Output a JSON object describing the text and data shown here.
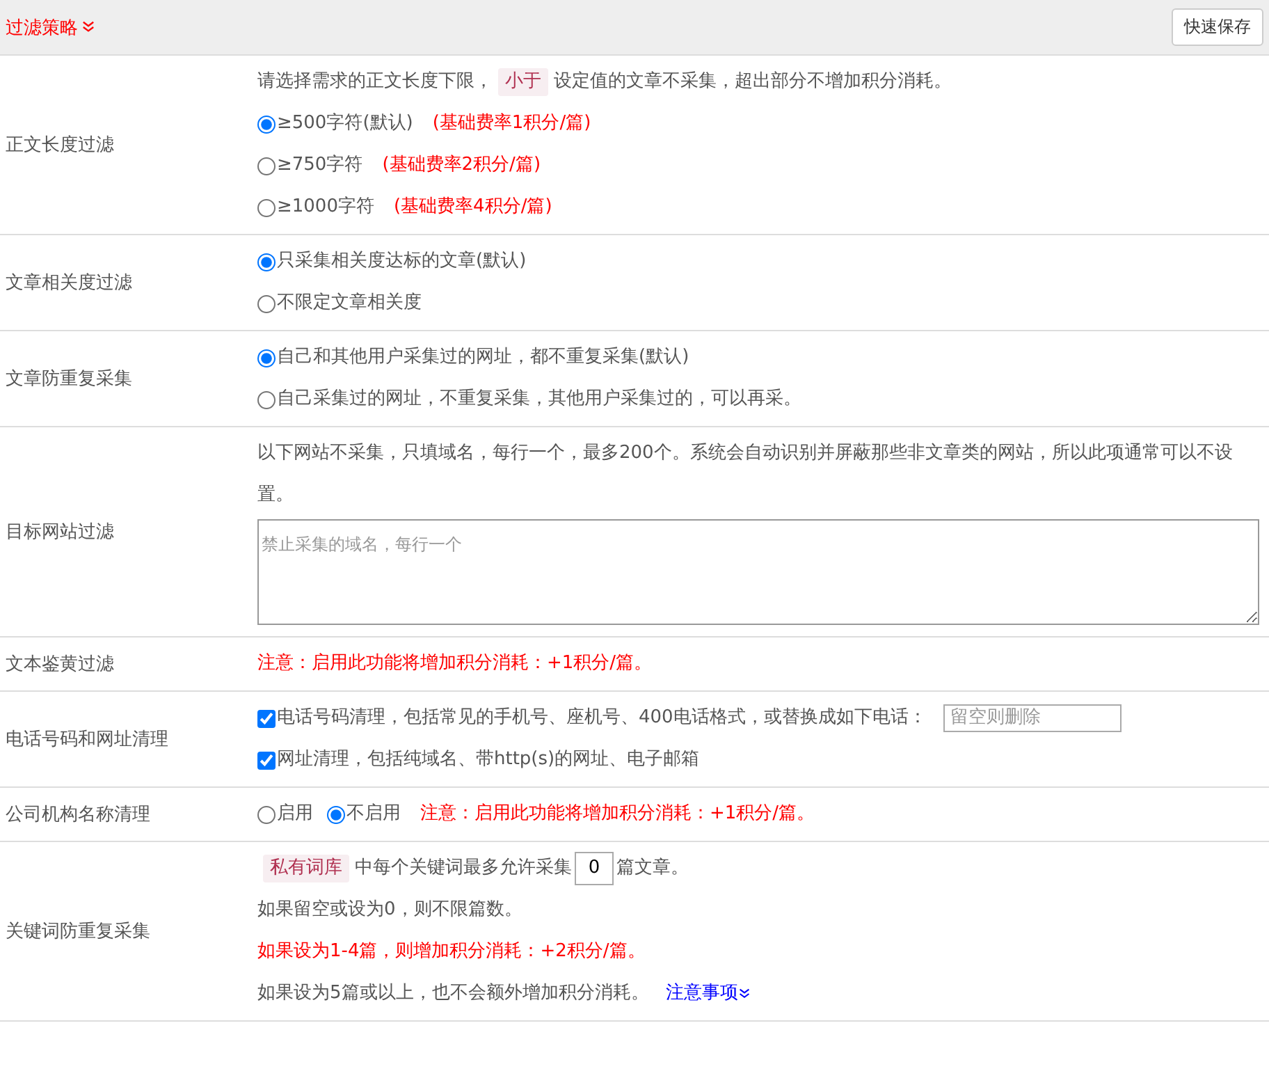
{
  "header": {
    "title": "过滤策略",
    "save_button": "快速保存"
  },
  "rows": [
    {
      "label": "正文长度过滤",
      "lines": [
        [
          {
            "kind": "text",
            "text": "请选择需求的正文长度下限，"
          },
          {
            "kind": "tag",
            "text": "小于"
          },
          {
            "kind": "text",
            "text": "设定值的文章不采集，超出部分不增加积分消耗。"
          }
        ],
        [
          {
            "kind": "radio",
            "text": "≥500字符(默认)",
            "selected": true
          },
          {
            "kind": "note",
            "text": "(基础费率1积分/篇)"
          }
        ],
        [
          {
            "kind": "radio",
            "text": "≥750字符",
            "selected": false
          },
          {
            "kind": "note",
            "text": "(基础费率2积分/篇)"
          }
        ],
        [
          {
            "kind": "radio",
            "text": "≥1000字符",
            "selected": false
          },
          {
            "kind": "note",
            "text": "(基础费率4积分/篇)"
          }
        ]
      ]
    },
    {
      "label": "文章相关度过滤",
      "lines": [
        [
          {
            "kind": "radio",
            "text": "只采集相关度达标的文章(默认)",
            "selected": true
          }
        ],
        [
          {
            "kind": "radio",
            "text": "不限定文章相关度",
            "selected": false
          }
        ]
      ]
    },
    {
      "label": "文章防重复采集",
      "lines": [
        [
          {
            "kind": "radio",
            "text": "自己和其他用户采集过的网址，都不重复采集(默认)",
            "selected": true
          }
        ],
        [
          {
            "kind": "radio",
            "text": "自己采集过的网址，不重复采集，其他用户采集过的，可以再采。",
            "selected": false
          }
        ]
      ]
    },
    {
      "label": "目标网站过滤",
      "lines": [
        [
          {
            "kind": "text",
            "text": "以下网站不采集，只填域名，每行一个，最多200个。系统会自动识别并屏蔽那些非文章类的网站，所以此项通常可以不设置。"
          }
        ],
        [
          {
            "kind": "textarea",
            "placeholder": "禁止采集的域名，每行一个"
          }
        ]
      ]
    },
    {
      "label": "文本鉴黄过滤",
      "lines": [
        [
          {
            "kind": "note",
            "text": "注意：启用此功能将增加积分消耗：+1积分/篇。"
          }
        ]
      ]
    },
    {
      "label": "电话号码和网址清理",
      "lines": [
        [
          {
            "kind": "checkbox",
            "text": "电话号码清理，包括常见的手机号、座机号、400电话格式，或替换成如下电话：",
            "checked": true
          },
          {
            "kind": "input",
            "placeholder": "留空则删除"
          }
        ],
        [
          {
            "kind": "checkbox",
            "text": "网址清理，包括纯域名、带http(s)的网址、电子邮箱",
            "checked": true
          }
        ]
      ]
    },
    {
      "label": "公司机构名称清理",
      "lines": [
        [
          {
            "kind": "radio",
            "text": "启用",
            "selected": false
          },
          {
            "kind": "radio",
            "text": "不启用",
            "selected": true
          },
          {
            "kind": "note",
            "text": "注意：启用此功能将增加积分消耗：+1积分/篇。"
          }
        ]
      ]
    },
    {
      "label": "关键词防重复采集",
      "lines": [
        [
          {
            "kind": "tag",
            "text": "私有词库"
          },
          {
            "kind": "text",
            "text": "中每个关键词最多允许采集"
          },
          {
            "kind": "number",
            "value": "0"
          },
          {
            "kind": "text",
            "text": "篇文章。"
          }
        ],
        [
          {
            "kind": "text",
            "text": "如果留空或设为0，则不限篇数。"
          }
        ],
        [
          {
            "kind": "note",
            "text": "如果设为1-4篇，则增加积分消耗：+2积分/篇。"
          }
        ],
        [
          {
            "kind": "text",
            "text": "如果设为5篇或以上，也不会额外增加积分消耗。"
          },
          {
            "kind": "link",
            "text": "注意事项"
          }
        ]
      ]
    }
  ]
}
